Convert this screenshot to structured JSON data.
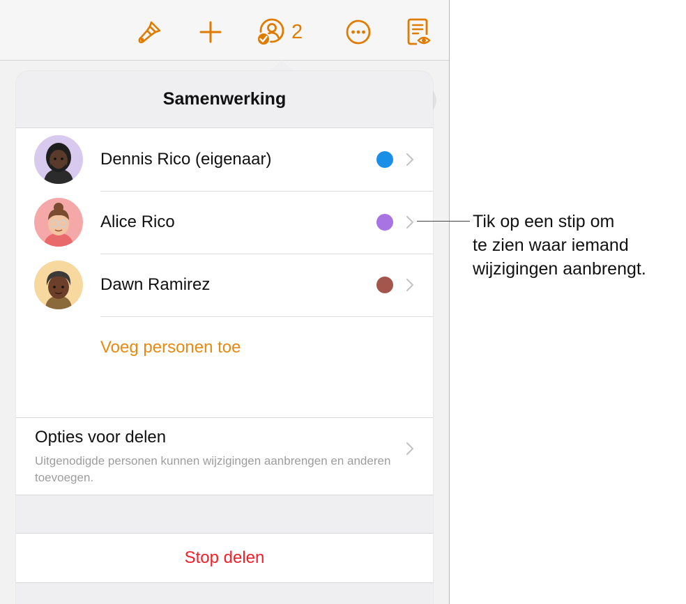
{
  "toolbar": {
    "collaborator_count": "2",
    "buttons": [
      "paintbrush-icon",
      "plus-icon",
      "collaboration-icon",
      "more-icon",
      "reader-view-icon"
    ],
    "accent_color": "#E07B00"
  },
  "popover": {
    "title": "Samenwerking",
    "participants": [
      {
        "name": "Dennis Rico (eigenaar)",
        "color": "#1A8FE8"
      },
      {
        "name": "Alice Rico",
        "color": "#A874E3"
      },
      {
        "name": "Dawn Ramirez",
        "color": "#A4564C"
      }
    ],
    "add_people_label": "Voeg personen toe",
    "sharing_options": {
      "title": "Opties voor delen",
      "subtitle": "Uitgenodigde personen kunnen wijzigingen aanbrengen en anderen toevoegen."
    },
    "stop_sharing_label": "Stop delen"
  },
  "callout": {
    "lines": [
      "Tik op een stip om",
      "te zien waar iemand",
      "wijzigingen aanbrengt."
    ]
  }
}
